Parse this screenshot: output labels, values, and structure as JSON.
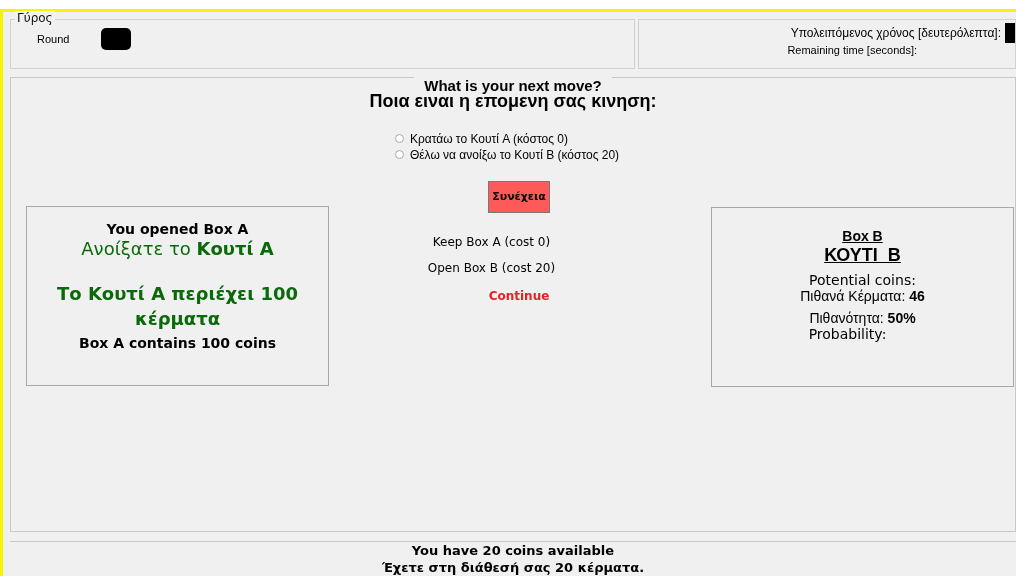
{
  "round_panel": {
    "legend": "Γύρος",
    "label": "Round"
  },
  "time_panel": {
    "label_greek": "Υπολειπόμενος χρόνος [δευτερόλεπτα]:",
    "label_english": "Remaining time [seconds]:"
  },
  "question": {
    "title_english": "What is your next move?",
    "title_greek": "Ποια ειναι η επομενη σας κινηση:"
  },
  "options": [
    {
      "label": "Κρατάω το Κουτί A (κόστος 0)",
      "selected": false
    },
    {
      "label": "Θέλω να ανοίξω το Κουτί Β  (κόστος 20)",
      "selected": false
    }
  ],
  "continue_button": "Συνέχεια",
  "english_options": [
    "Keep Box A (cost 0)",
    "Open Box B (cost 20)"
  ],
  "continue_english": "Continue",
  "box_a": {
    "title_english": "You opened Box A",
    "title_greek": "Ανοίξατε το **Κουτί A**",
    "contents_greek": "Το Κουτί A περιέχει 100 κέρματα",
    "contents_english": "Box A contains 100 coins"
  },
  "box_b": {
    "title_english": "Box B",
    "title_greek": "ΚΟΥΤΙ  Β",
    "coins_english": "Potential coins:",
    "coins_greek": "Πιθανά Κέρματα: **46**",
    "probability_greek": "Πιθανότητα: **50%**",
    "probability_english": "Probability:"
  },
  "footer": {
    "english": "You have 20 coins available",
    "greek": "Έχετε στη διάθεσή σας 20 κέρματα."
  }
}
